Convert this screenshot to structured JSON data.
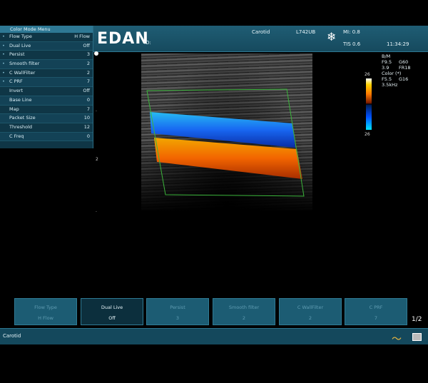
{
  "header": {
    "logo": "EDAN",
    "id_label": "ID:",
    "preset": "Carotid",
    "probe": "L742UB",
    "freeze_icon": "snowflake-icon",
    "mi": "MI: 0.8",
    "tis": "TIS 0.6",
    "time": "11:34:29"
  },
  "menu": {
    "title": "Color Mode Menu",
    "items": [
      {
        "label": "Flow Type",
        "value": "H Flow"
      },
      {
        "label": "Dual Live",
        "value": "Off"
      },
      {
        "label": "Persist",
        "value": "3"
      },
      {
        "label": "Smooth filter",
        "value": "2"
      },
      {
        "label": "C WallFilter",
        "value": "2"
      },
      {
        "label": "C PRF",
        "value": "7"
      },
      {
        "label": "Invert",
        "value": "Off"
      },
      {
        "label": "Base Line",
        "value": "0"
      },
      {
        "label": "Map",
        "value": "7"
      },
      {
        "label": "Packet Size",
        "value": "10"
      },
      {
        "label": "Threshold",
        "value": "12"
      },
      {
        "label": "C Freq",
        "value": "0"
      }
    ]
  },
  "info": {
    "bm": "B/M",
    "f": "F9.5",
    "g": "G60",
    "d": "3.9",
    "fr": "FR18",
    "color": "Color (*)",
    "cf": "F5.5",
    "cg": "G16",
    "prf": "3.5kHz",
    "scale_top": "26",
    "scale_bottom": "26"
  },
  "depth_mark": "2",
  "softkeys": [
    {
      "title": "Flow Type",
      "value": "H Flow",
      "active": false
    },
    {
      "title": "Dual Live",
      "value": "Off",
      "active": true
    },
    {
      "title": "Persist",
      "value": "3",
      "active": false
    },
    {
      "title": "Smooth filter",
      "value": "2",
      "active": false
    },
    {
      "title": "C WallFilter",
      "value": "2",
      "active": false
    },
    {
      "title": "C PRF",
      "value": "7",
      "active": false
    }
  ],
  "pager": "1/2",
  "status": {
    "label": "Carotid",
    "wave_icon": "waveform-icon",
    "printer_icon": "printer-icon"
  },
  "colors": {
    "panel": "#164a5e",
    "menu": "#0f3646",
    "accent": "#2e7894",
    "flow_blue": "#1e7bff",
    "flow_orange": "#ff6a00",
    "roi": "#3fbf3f"
  }
}
